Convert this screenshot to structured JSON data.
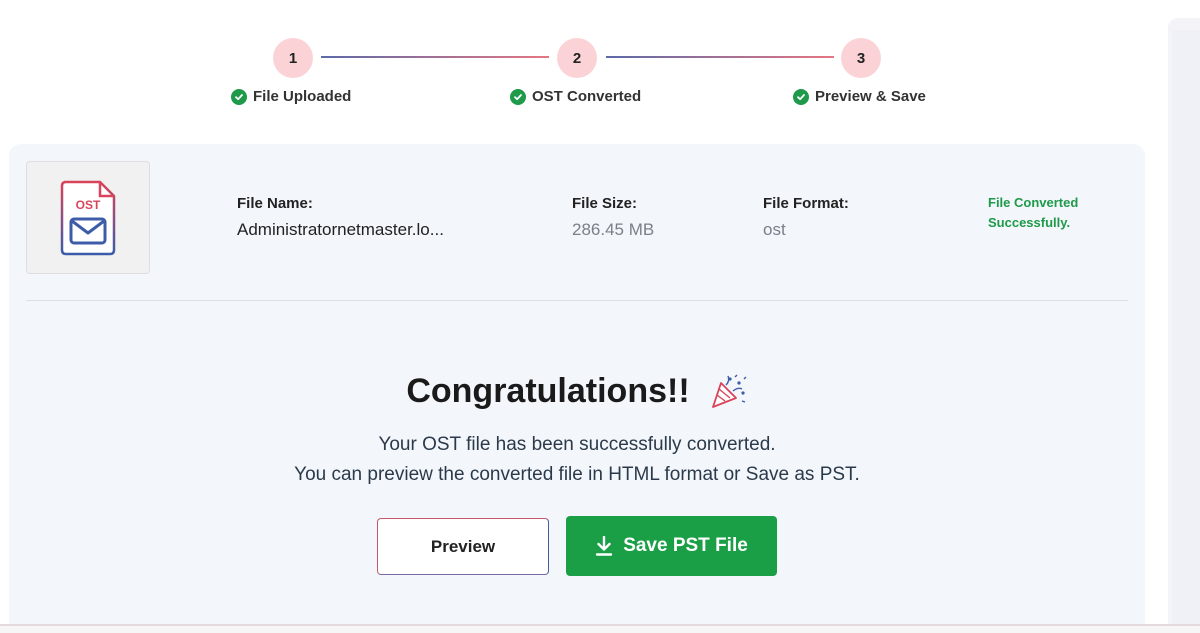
{
  "stepper": {
    "steps": [
      {
        "number": "1",
        "label": "File Uploaded"
      },
      {
        "number": "2",
        "label": "OST Converted"
      },
      {
        "number": "3",
        "label": "Preview & Save"
      }
    ]
  },
  "file": {
    "icon_text": "OST",
    "name_label": "File Name:",
    "name_value": "Administratornetmaster.lo...",
    "size_label": "File Size:",
    "size_value": "286.45 MB",
    "format_label": "File Format:",
    "format_value": "ost",
    "status": "File Converted Successfully."
  },
  "result": {
    "heading": "Congratulations!!",
    "message_line1": "Your OST file has been successfully converted.",
    "message_line2": "You can preview the converted file in HTML format or Save as PST."
  },
  "actions": {
    "preview_label": "Preview",
    "save_label": "Save PST File"
  },
  "colors": {
    "accent_green": "#1a9f47",
    "step_circle": "#fbd3d6",
    "ost_red": "#d9445a",
    "ost_blue": "#3c5ca8"
  },
  "icons": {
    "check": "check-circle-icon",
    "file": "ost-file-icon",
    "party": "party-popper-icon",
    "download": "download-icon"
  }
}
